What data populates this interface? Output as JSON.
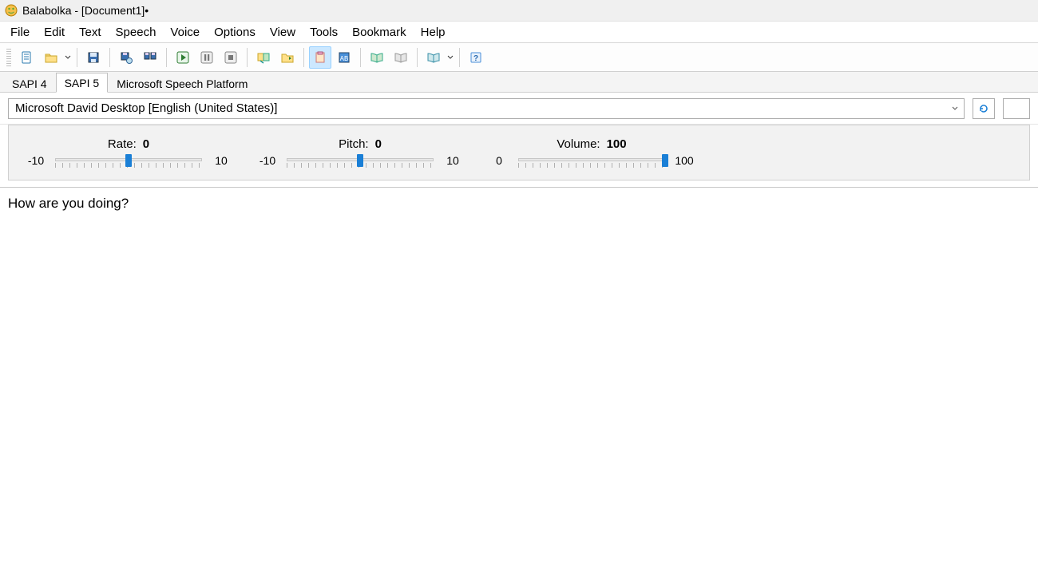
{
  "title": "Balabolka - [Document1]•",
  "menu": [
    "File",
    "Edit",
    "Text",
    "Speech",
    "Voice",
    "Options",
    "View",
    "Tools",
    "Bookmark",
    "Help"
  ],
  "toolbar": {
    "new": "new-file",
    "open": "open-file",
    "save": "save-file",
    "printpreview": "print-preview",
    "print": "print",
    "play": "play",
    "pause": "pause",
    "stop": "stop",
    "convertbatch": "batch-convert",
    "convertsingle": "convert-folder",
    "panel1": "clipboard-panel",
    "panel2": "dictionary-panel",
    "bookmark1": "bookmark-read",
    "bookmark2": "bookmark-grey",
    "spell": "spellcheck",
    "help": "help"
  },
  "speech_tabs": {
    "items": [
      "SAPI 4",
      "SAPI 5",
      "Microsoft Speech Platform"
    ],
    "active": 1
  },
  "voice": {
    "selected": "Microsoft David Desktop [English (United States)]"
  },
  "sliders": {
    "rate": {
      "label": "Rate:",
      "value": "0",
      "min": "-10",
      "max": "10",
      "pos_pct": 50
    },
    "pitch": {
      "label": "Pitch:",
      "value": "0",
      "min": "-10",
      "max": "10",
      "pos_pct": 50
    },
    "volume": {
      "label": "Volume:",
      "value": "100",
      "min": "0",
      "max": "100",
      "pos_pct": 100
    }
  },
  "document_text": "How are you doing?"
}
